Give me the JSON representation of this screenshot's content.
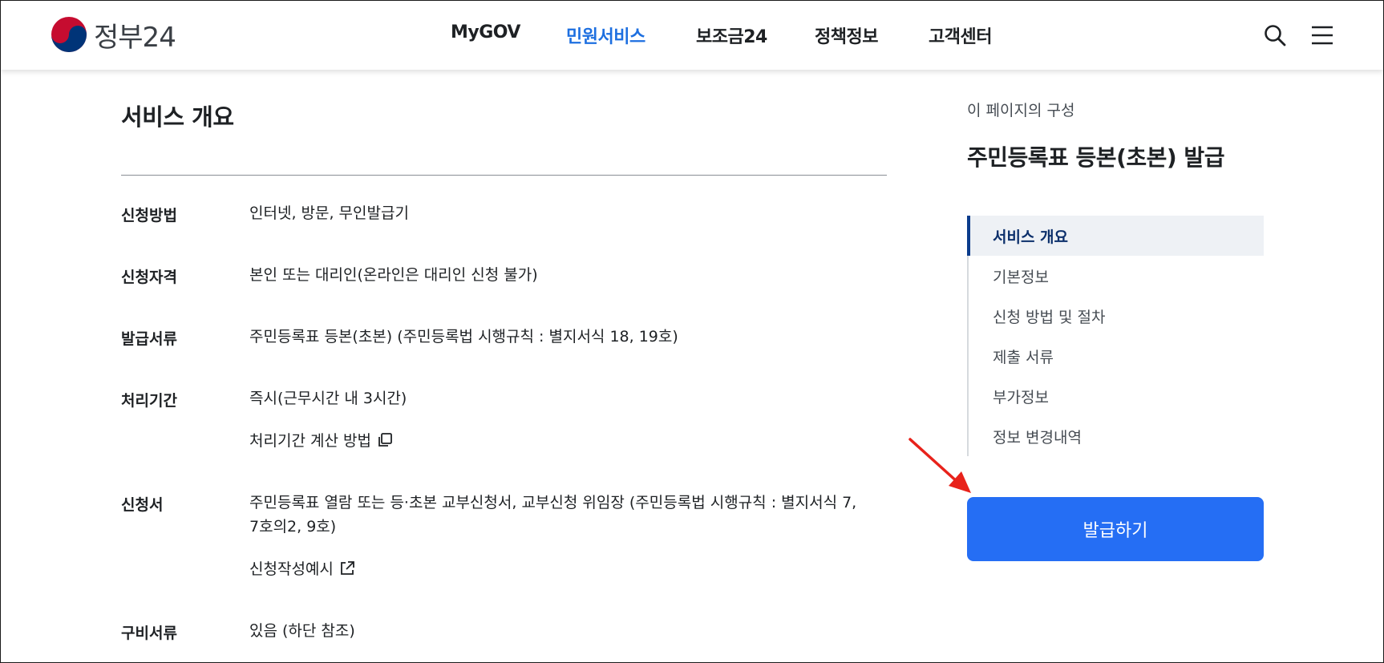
{
  "header": {
    "logo_text": "정부24",
    "nav": [
      {
        "label": "MyGOV"
      },
      {
        "label": "민원서비스"
      },
      {
        "label": "보조금24"
      },
      {
        "label": "정책정보"
      },
      {
        "label": "고객센터"
      }
    ],
    "active_nav": "민원서비스",
    "icons": [
      "search-icon",
      "menu-icon"
    ]
  },
  "main": {
    "section_title": "서비스 개요",
    "rows": [
      {
        "label": "신청방법",
        "value": "인터넷, 방문, 무인발급기"
      },
      {
        "label": "신청자격",
        "value": "본인 또는 대리인(온라인은 대리인 신청 불가)"
      },
      {
        "label": "발급서류",
        "value": "주민등록표 등본(초본) (주민등록법 시행규칙 : 별지서식 18, 19호)"
      },
      {
        "label": "처리기간",
        "value": "즉시(근무시간 내 3시간)",
        "link": "처리기간 계산 방법"
      },
      {
        "label": "신청서",
        "value_line1": "주민등록표 열람 또는 등·초본 교부신청서, 교부신청 위임장 (주민등록법 시행규칙 : 별지서식 7,",
        "value_line2": "7호의2, 9호)",
        "link": "신청작성예시"
      },
      {
        "label": "구비서류",
        "value": "있음 (하단 참조)"
      }
    ]
  },
  "aside": {
    "caption": "이 페이지의 구성",
    "title": "주민등록표 등본(초본) 발급",
    "toc": [
      {
        "label": "서비스 개요",
        "active": true
      },
      {
        "label": "기본정보"
      },
      {
        "label": "신청 방법 및 절차"
      },
      {
        "label": "제출 서류"
      },
      {
        "label": "부가정보"
      },
      {
        "label": "정보 변경내역"
      }
    ],
    "issue_button": "발급하기"
  },
  "colors": {
    "accent_blue": "#256ef4",
    "nav_active": "#1d6fe0",
    "toc_active_bar": "#0b3c8c",
    "annotation_arrow": "#e8221b"
  }
}
